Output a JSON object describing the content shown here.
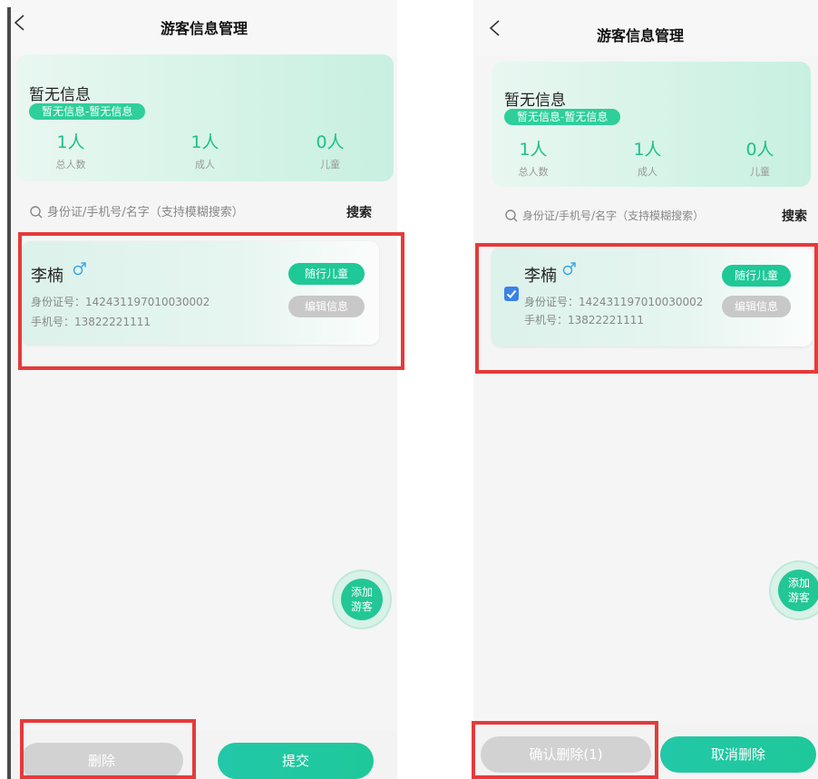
{
  "header": {
    "title": "游客信息管理"
  },
  "summary": {
    "title": "暂无信息",
    "tag": "暂无信息-暂无信息",
    "stats": [
      {
        "value": "1人",
        "label": "总人数"
      },
      {
        "value": "1人",
        "label": "成人"
      },
      {
        "value": "0人",
        "label": "儿童"
      }
    ]
  },
  "search": {
    "placeholder": "身份证/手机号/名字（支持模糊搜索）",
    "button_label": "搜索"
  },
  "visitor": {
    "name": "李楠",
    "id_line": "身份证号：142431197010030002",
    "phone_line": "手机号：13822221111",
    "child_button": "随行儿童",
    "edit_button": "编辑信息"
  },
  "fab": {
    "line1": "添加",
    "line2": "游客"
  },
  "left_screen": {
    "delete_label": "删除",
    "submit_label": "提交"
  },
  "right_screen": {
    "checkbox_checked": true,
    "confirm_delete_label": "确认删除(1)",
    "cancel_delete_label": "取消删除"
  },
  "colors": {
    "accent": "#1fc897",
    "highlight": "#e63a3a",
    "checkbox": "#3b82e6",
    "male_icon": "#3aa7e6"
  },
  "icons": [
    "back-icon",
    "search-icon",
    "male-icon",
    "check-icon"
  ]
}
